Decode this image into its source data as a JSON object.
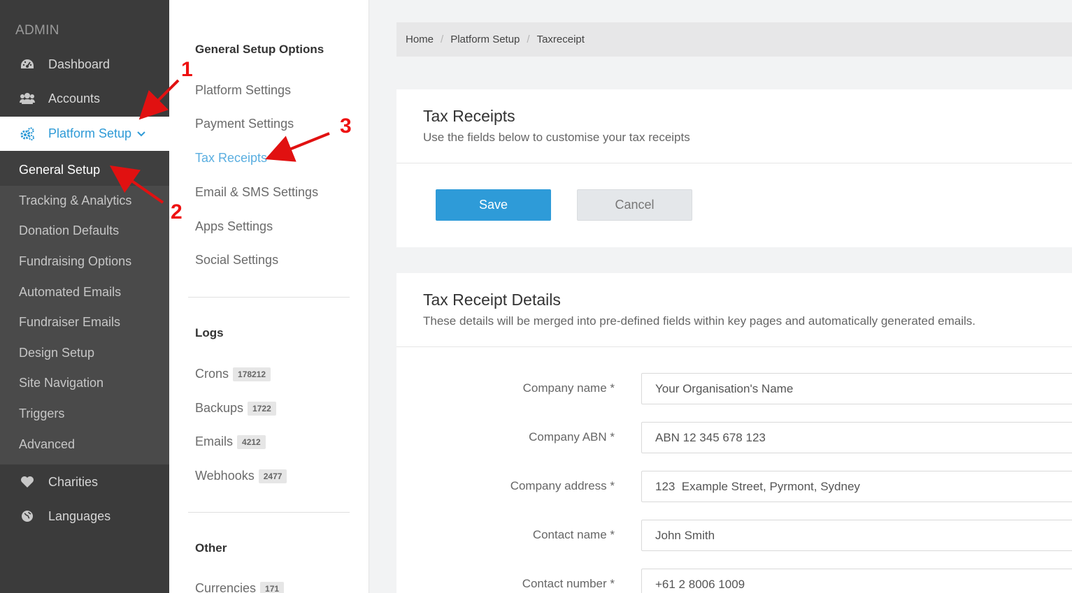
{
  "sidebar": {
    "admin_label": "ADMIN",
    "items": [
      {
        "label": "Dashboard",
        "icon": "dashboard-icon"
      },
      {
        "label": "Accounts",
        "icon": "users-icon"
      },
      {
        "label": "Platform Setup",
        "icon": "gears-icon"
      }
    ],
    "submenu": [
      "General Setup",
      "Tracking & Analytics",
      "Donation Defaults",
      "Fundraising Options",
      "Automated Emails",
      "Fundraiser Emails",
      "Design Setup",
      "Site Navigation",
      "Triggers",
      "Advanced"
    ],
    "bottom_items": [
      {
        "label": "Charities",
        "icon": "heart-icon"
      },
      {
        "label": "Languages",
        "icon": "globe-icon"
      }
    ]
  },
  "setup_options": {
    "heading": "General Setup Options",
    "links": [
      "Platform Settings",
      "Payment Settings",
      "Tax Receipts",
      "Email & SMS Settings",
      "Apps Settings",
      "Social Settings"
    ],
    "logs_heading": "Logs",
    "logs": [
      {
        "label": "Crons",
        "count": "178212"
      },
      {
        "label": "Backups",
        "count": "1722"
      },
      {
        "label": "Emails",
        "count": "4212"
      },
      {
        "label": "Webhooks",
        "count": "2477"
      }
    ],
    "other_heading": "Other",
    "other": [
      {
        "label": "Currencies",
        "count": "171"
      }
    ]
  },
  "breadcrumb": [
    "Home",
    "Platform Setup",
    "Taxreceipt"
  ],
  "tax_receipts_card": {
    "title": "Tax Receipts",
    "subtitle": "Use the fields below to customise your tax receipts",
    "save_label": "Save",
    "cancel_label": "Cancel"
  },
  "details_card": {
    "title": "Tax Receipt Details",
    "subtitle": "These details will be merged into pre-defined fields within key pages and automatically generated emails.",
    "fields": [
      {
        "label": "Company name *",
        "value": "Your Organisation's Name"
      },
      {
        "label": "Company ABN *",
        "value": "ABN 12 345 678 123"
      },
      {
        "label": "Company address *",
        "value": "123  Example Street, Pyrmont, Sydney"
      },
      {
        "label": "Contact name *",
        "value": "John Smith"
      },
      {
        "label": "Contact number *",
        "value": "+61 2 8006 1009"
      }
    ]
  },
  "annotations": [
    "1",
    "2",
    "3"
  ],
  "colors": {
    "accent": "#2e9bd8",
    "sidebar_bg": "#3b3b3b",
    "submenu_bg": "#4a4a4a",
    "annotation_red": "#e11111"
  }
}
